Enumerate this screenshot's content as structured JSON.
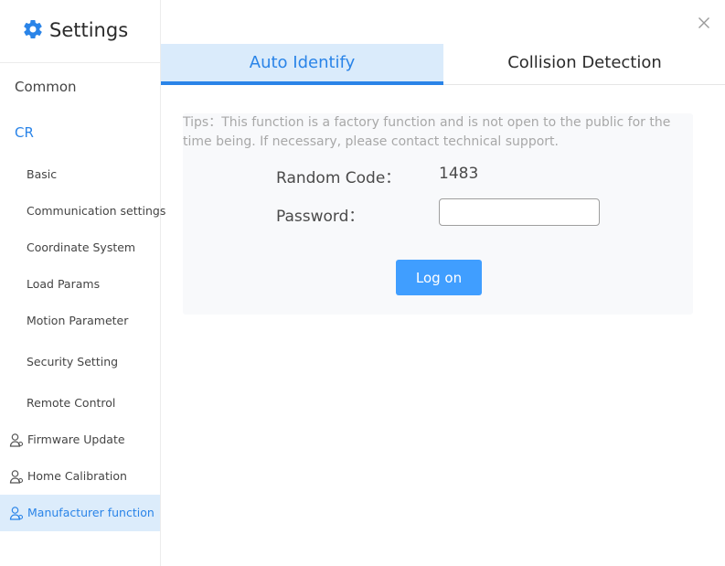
{
  "sidebar": {
    "title": "Settings",
    "brand_icon": "gear-icon",
    "items": [
      {
        "label": "Common"
      },
      {
        "label": "CR"
      }
    ],
    "sub_items": [
      {
        "label": "Basic"
      },
      {
        "label": "Communication settings"
      },
      {
        "label": "Coordinate System"
      },
      {
        "label": "Load Params"
      },
      {
        "label": "Motion Parameter"
      },
      {
        "label": "Security Setting"
      },
      {
        "label": "Remote Control"
      }
    ],
    "icon_items": [
      {
        "label": "Firmware Update",
        "icon": "user-icon"
      },
      {
        "label": "Home Calibration",
        "icon": "user-icon"
      },
      {
        "label": "Manufacturer function",
        "icon": "user-icon",
        "selected": true
      }
    ]
  },
  "tabs": [
    {
      "label": "Auto Identify",
      "active": true
    },
    {
      "label": "Collision Detection",
      "active": false
    }
  ],
  "panel": {
    "tips": "Tips：This function is a factory function and is not open to the public for the time being. If necessary, please contact technical support.",
    "random_code_label": "Random Code：",
    "random_code_value": "1483",
    "password_label": "Password：",
    "password_value": "",
    "password_placeholder": "",
    "login_label": "Log on"
  },
  "colors": {
    "accent": "#2a84e8",
    "tab_active_bg": "#daebfb",
    "button_bg": "#409eff"
  }
}
